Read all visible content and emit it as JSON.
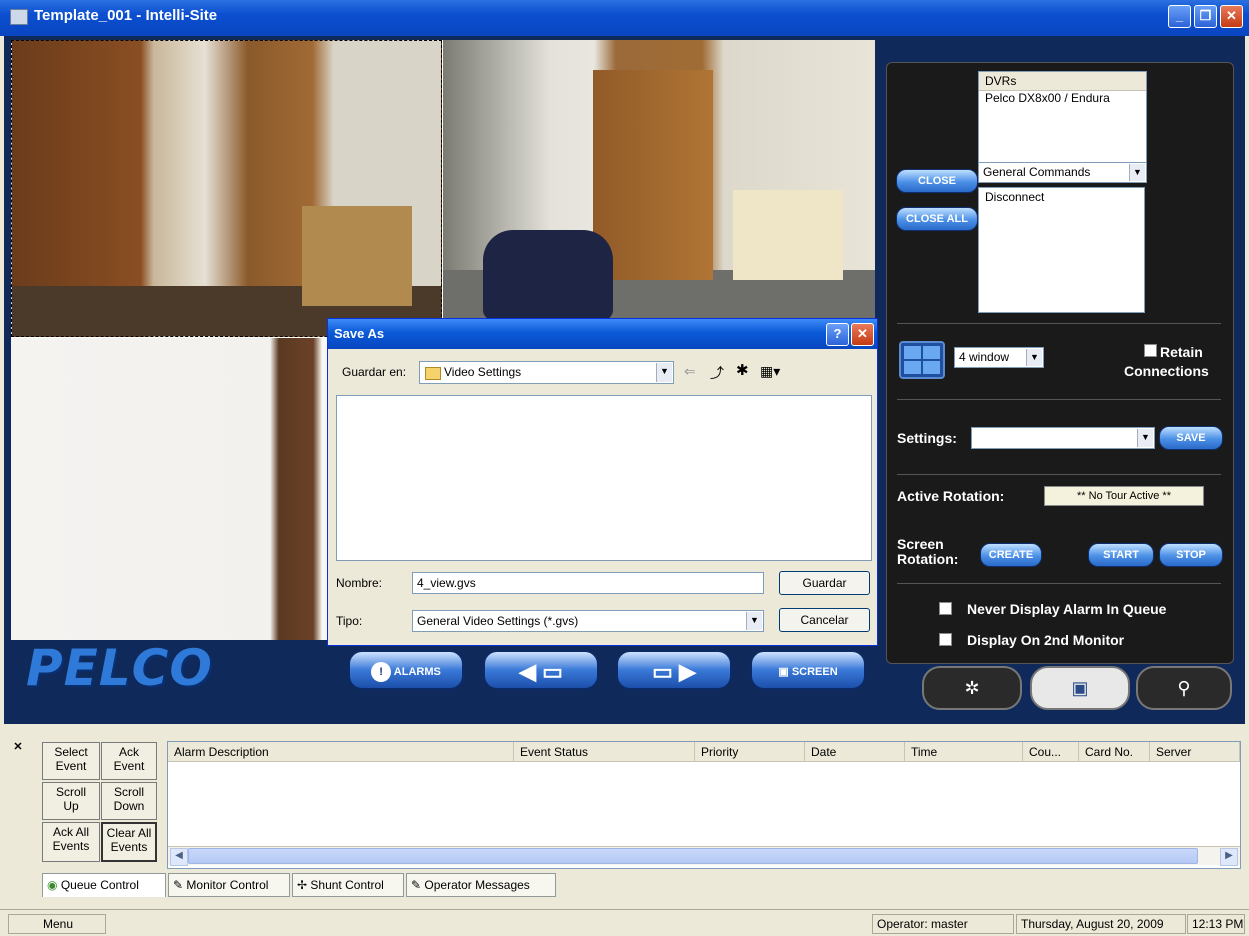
{
  "window": {
    "title": "Template_001 - Intelli-Site"
  },
  "right_panel": {
    "dvr_list_header": "DVRs",
    "dvr_items": [
      "Pelco DX8x00 / Endura"
    ],
    "close_label": "CLOSE",
    "close_all_label": "CLOSE ALL",
    "commands_value": "General Commands",
    "commands_items": [
      "Disconnect"
    ],
    "layout_value": "4 window",
    "retain_label": "Retain",
    "connections_label": "Connections",
    "settings_label": "Settings:",
    "save_label": "SAVE",
    "active_rotation_label": "Active Rotation:",
    "active_rotation_value": "** No Tour Active **",
    "screen_label": "Screen",
    "rotation_label": "Rotation:",
    "create_label": "CREATE",
    "start_label": "START",
    "stop_label": "STOP",
    "never_display_label": "Never Display Alarm In Queue",
    "display_2nd_label": "Display On 2nd Monitor"
  },
  "strip": {
    "logo": "PELCO",
    "alarms_label": "ALARMS",
    "screen_label": "SCREEN"
  },
  "dialog": {
    "title": "Save As",
    "save_in_label": "Guardar en:",
    "save_in_value": "Video Settings",
    "name_label": "Nombre:",
    "name_value": "4_view.gvs",
    "type_label": "Tipo:",
    "type_value": "General Video Settings (*.gvs)",
    "save_button": "Guardar",
    "cancel_button": "Cancelar"
  },
  "queue": {
    "buttons": [
      {
        "l1": "Select",
        "l2": "Event"
      },
      {
        "l1": "Ack",
        "l2": "Event"
      },
      {
        "l1": "Scroll",
        "l2": "Up"
      },
      {
        "l1": "Scroll",
        "l2": "Down"
      },
      {
        "l1": "Ack All",
        "l2": "Events"
      },
      {
        "l1": "Clear All",
        "l2": "Events"
      }
    ],
    "columns": [
      "Alarm Description",
      "Event Status",
      "Priority",
      "Date",
      "Time",
      "Cou...",
      "Card No.",
      "Server"
    ]
  },
  "tabs": [
    "Queue Control",
    "Monitor Control",
    "Shunt Control",
    "Operator Messages"
  ],
  "statusbar": {
    "menu": "Menu",
    "operator": "Operator: master",
    "date": "Thursday, August 20, 2009",
    "time": "12:13 PM"
  }
}
